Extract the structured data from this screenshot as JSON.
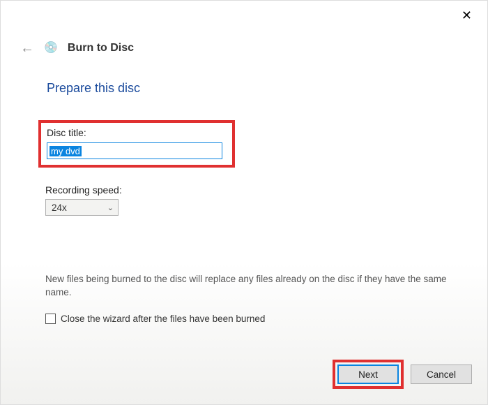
{
  "header": {
    "wizard_title": "Burn to Disc"
  },
  "main": {
    "heading": "Prepare this disc",
    "disc_title_label": "Disc title:",
    "disc_title_value": "my dvd",
    "recording_speed_label": "Recording speed:",
    "recording_speed_value": "24x",
    "info_text": "New files being burned to the disc will replace any files already on the disc if they have the same name.",
    "checkbox_label": "Close the wizard after the files have been burned",
    "checkbox_checked": false
  },
  "buttons": {
    "next_label": "Next",
    "cancel_label": "Cancel"
  }
}
